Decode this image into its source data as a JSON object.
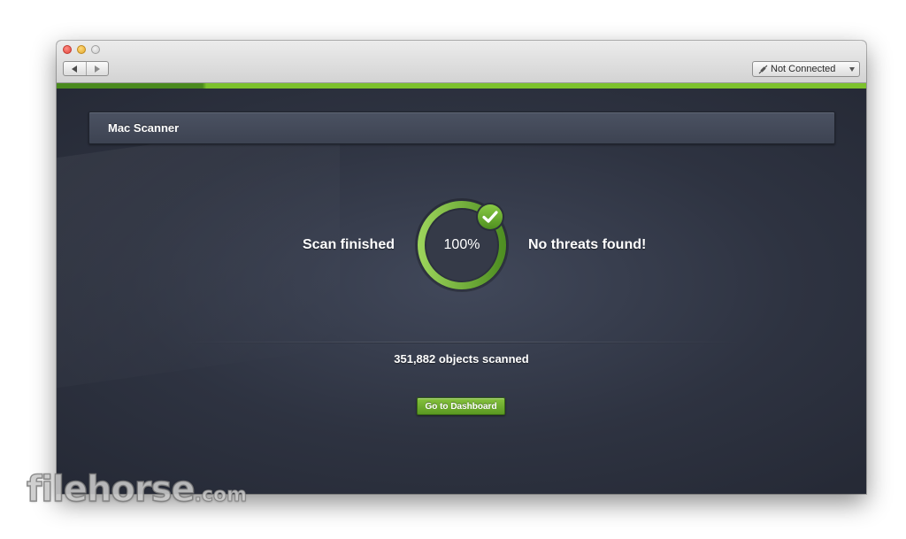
{
  "window": {
    "titlebar": {
      "traffic_lights": [
        "close",
        "minimize",
        "zoom"
      ],
      "nav_icons": [
        "back-arrow-icon",
        "forward-arrow-icon"
      ],
      "connection": {
        "icon": "plug-icon",
        "label": "Not Connected"
      }
    },
    "accent_color": "#7dc22d",
    "background_color": "#2e3341"
  },
  "panel": {
    "title": "Mac Scanner"
  },
  "scan": {
    "status_left": "Scan finished",
    "percent_label": "100%",
    "progress": 1.0,
    "status_right": "No threats found!",
    "objects_scanned": "351,882 objects scanned",
    "check_icon": "checkmark-icon"
  },
  "actions": {
    "dashboard_label": "Go to Dashboard"
  },
  "watermark": {
    "brand": "filehorse",
    "domain": ".com"
  }
}
